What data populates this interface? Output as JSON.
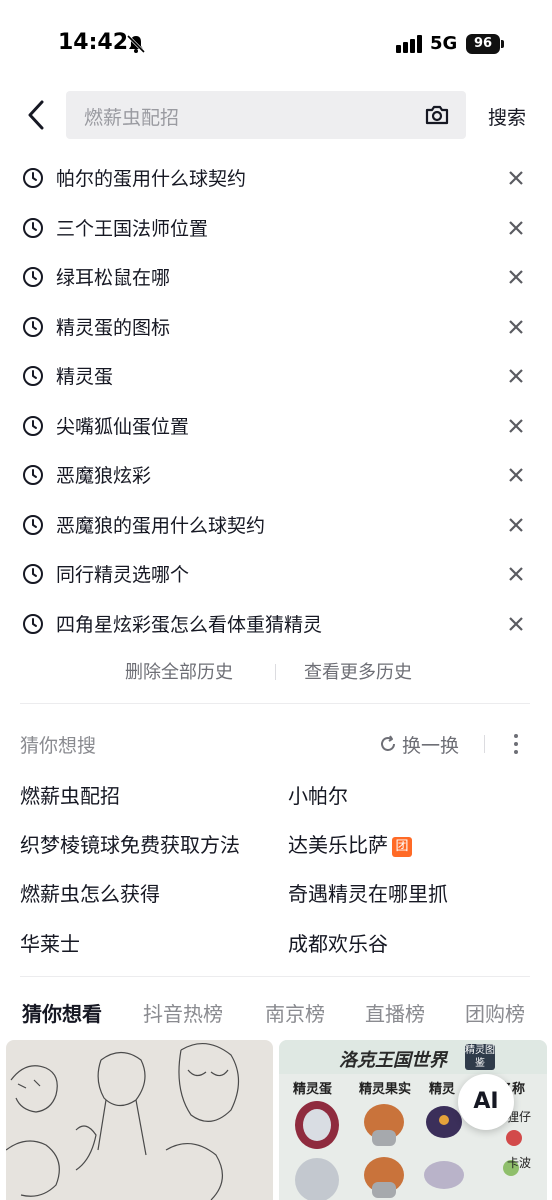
{
  "status_bar": {
    "time": "14:42",
    "network": "5G",
    "battery": "96"
  },
  "search": {
    "placeholder": "燃薪虫配招",
    "button": "搜索"
  },
  "history": [
    "帕尔的蛋用什么球契约",
    "三个王国法师位置",
    "绿耳松鼠在哪",
    "精灵蛋的图标",
    "精灵蛋",
    "尖嘴狐仙蛋位置",
    "恶魔狼炫彩",
    "恶魔狼的蛋用什么球契约",
    "同行精灵选哪个",
    "四角星炫彩蛋怎么看体重猜精灵"
  ],
  "history_actions": {
    "delete_all": "删除全部历史",
    "see_more": "查看更多历史"
  },
  "guess": {
    "title": "猜你想搜",
    "refresh": "换一换",
    "items": [
      {
        "text": "燃薪虫配招"
      },
      {
        "text": "小帕尔"
      },
      {
        "text": "织梦棱镜球免费获取方法"
      },
      {
        "text": "达美乐比萨",
        "badge": "团"
      },
      {
        "text": "燃薪虫怎么获得"
      },
      {
        "text": "奇遇精灵在哪里抓"
      },
      {
        "text": "华莱士"
      },
      {
        "text": "成都欢乐谷"
      }
    ]
  },
  "tabs": [
    "猜你想看",
    "抖音热榜",
    "南京榜",
    "直播榜",
    "团购榜"
  ],
  "cards": {
    "right_title": "洛克王国世界",
    "right_badge": "精灵图鉴",
    "right_columns": [
      "精灵蛋",
      "精灵果实",
      "精灵",
      "名称"
    ],
    "right_labels": [
      "狸仔",
      "卡波"
    ]
  },
  "ai_button": "AI",
  "colors": {
    "text": "#161823",
    "muted": "#8a8b90",
    "badge": "#ff6a26",
    "search_bg": "#eeeef0"
  }
}
